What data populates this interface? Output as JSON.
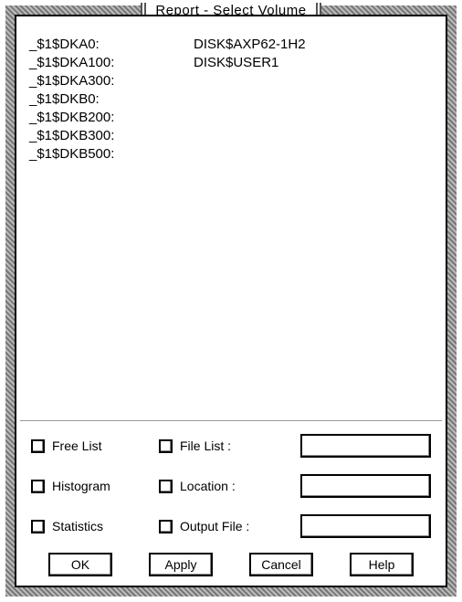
{
  "window": {
    "title": "Report - Select Volume"
  },
  "volumes": [
    {
      "device": "_$1$DKA0:",
      "label": "DISK$AXP62-1H2"
    },
    {
      "device": "_$1$DKA100:",
      "label": "DISK$USER1"
    },
    {
      "device": "_$1$DKA300:",
      "label": ""
    },
    {
      "device": "_$1$DKB0:",
      "label": ""
    },
    {
      "device": "_$1$DKB200:",
      "label": ""
    },
    {
      "device": "_$1$DKB300:",
      "label": ""
    },
    {
      "device": "_$1$DKB500:",
      "label": ""
    }
  ],
  "options": {
    "free_list": {
      "label": "Free List",
      "checked": false
    },
    "histogram": {
      "label": "Histogram",
      "checked": false
    },
    "statistics": {
      "label": "Statistics",
      "checked": false
    },
    "file_list": {
      "label": "File List :",
      "checked": false,
      "value": ""
    },
    "location": {
      "label": "Location :",
      "checked": false,
      "value": ""
    },
    "output_file": {
      "label": "Output File :",
      "checked": false,
      "value": ""
    }
  },
  "buttons": {
    "ok": "OK",
    "apply": "Apply",
    "cancel": "Cancel",
    "help": "Help"
  }
}
